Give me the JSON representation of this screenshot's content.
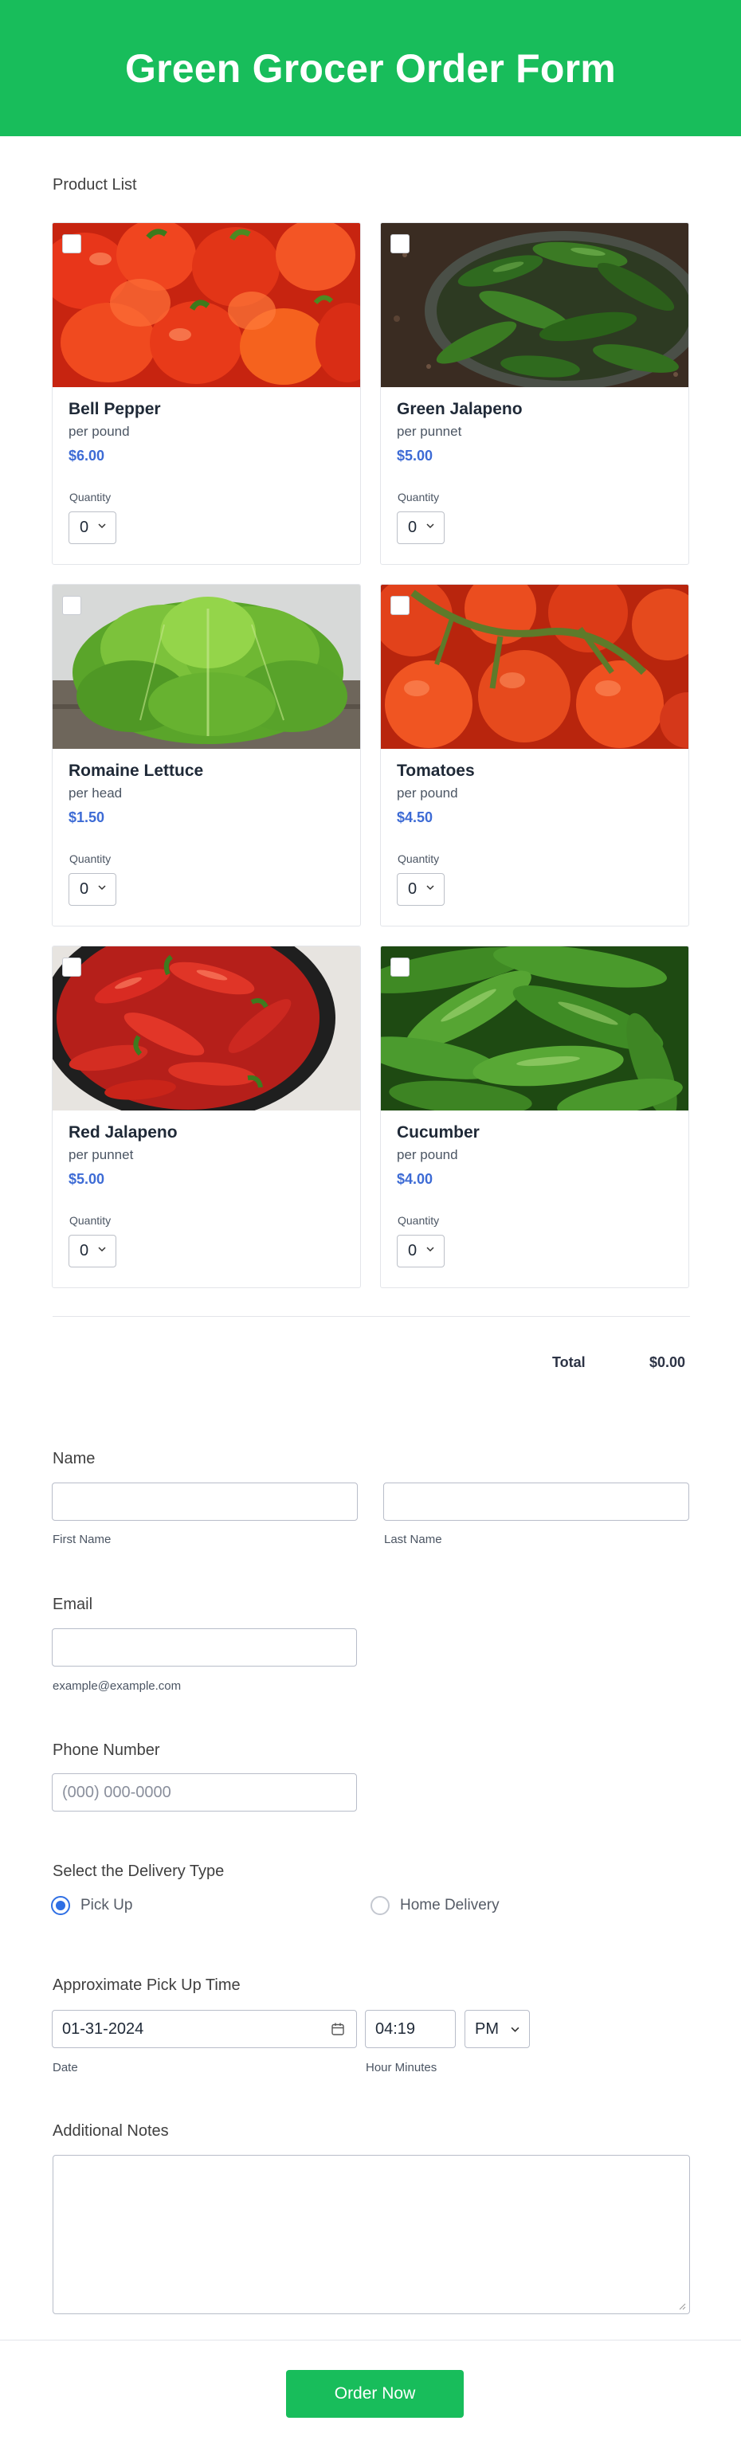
{
  "header": {
    "title": "Green Grocer Order Form"
  },
  "product_list": {
    "label": "Product List",
    "products": [
      {
        "name": "Bell Pepper",
        "unit": "per pound",
        "price": "$6.00",
        "quantity_label": "Quantity",
        "quantity": "0"
      },
      {
        "name": "Green Jalapeno",
        "unit": "per punnet",
        "price": "$5.00",
        "quantity_label": "Quantity",
        "quantity": "0"
      },
      {
        "name": "Romaine Lettuce",
        "unit": "per head",
        "price": "$1.50",
        "quantity_label": "Quantity",
        "quantity": "0"
      },
      {
        "name": "Tomatoes",
        "unit": "per pound",
        "price": "$4.50",
        "quantity_label": "Quantity",
        "quantity": "0"
      },
      {
        "name": "Red Jalapeno",
        "unit": "per punnet",
        "price": "$5.00",
        "quantity_label": "Quantity",
        "quantity": "0"
      },
      {
        "name": "Cucumber",
        "unit": "per pound",
        "price": "$4.00",
        "quantity_label": "Quantity",
        "quantity": "0"
      }
    ],
    "total_label": "Total",
    "total_value": "$0.00"
  },
  "name": {
    "label": "Name",
    "first_sublabel": "First Name",
    "last_sublabel": "Last Name",
    "first_value": "",
    "last_value": ""
  },
  "email": {
    "label": "Email",
    "sublabel": "example@example.com",
    "value": ""
  },
  "phone": {
    "label": "Phone Number",
    "placeholder": "(000) 000-0000"
  },
  "delivery": {
    "label": "Select the Delivery Type",
    "options": [
      "Pick Up",
      "Home Delivery"
    ],
    "selected": "Pick Up"
  },
  "pickup_time": {
    "label": "Approximate Pick Up Time",
    "date": "01-31-2024",
    "time": "04:19",
    "ampm": "PM",
    "date_sublabel": "Date",
    "time_sublabel": "Hour Minutes"
  },
  "notes": {
    "label": "Additional Notes",
    "value": ""
  },
  "submit": {
    "label": "Order Now"
  },
  "colors": {
    "brand": "#18bd5b",
    "price": "#3d6bd5",
    "radio": "#2f6fe4"
  }
}
